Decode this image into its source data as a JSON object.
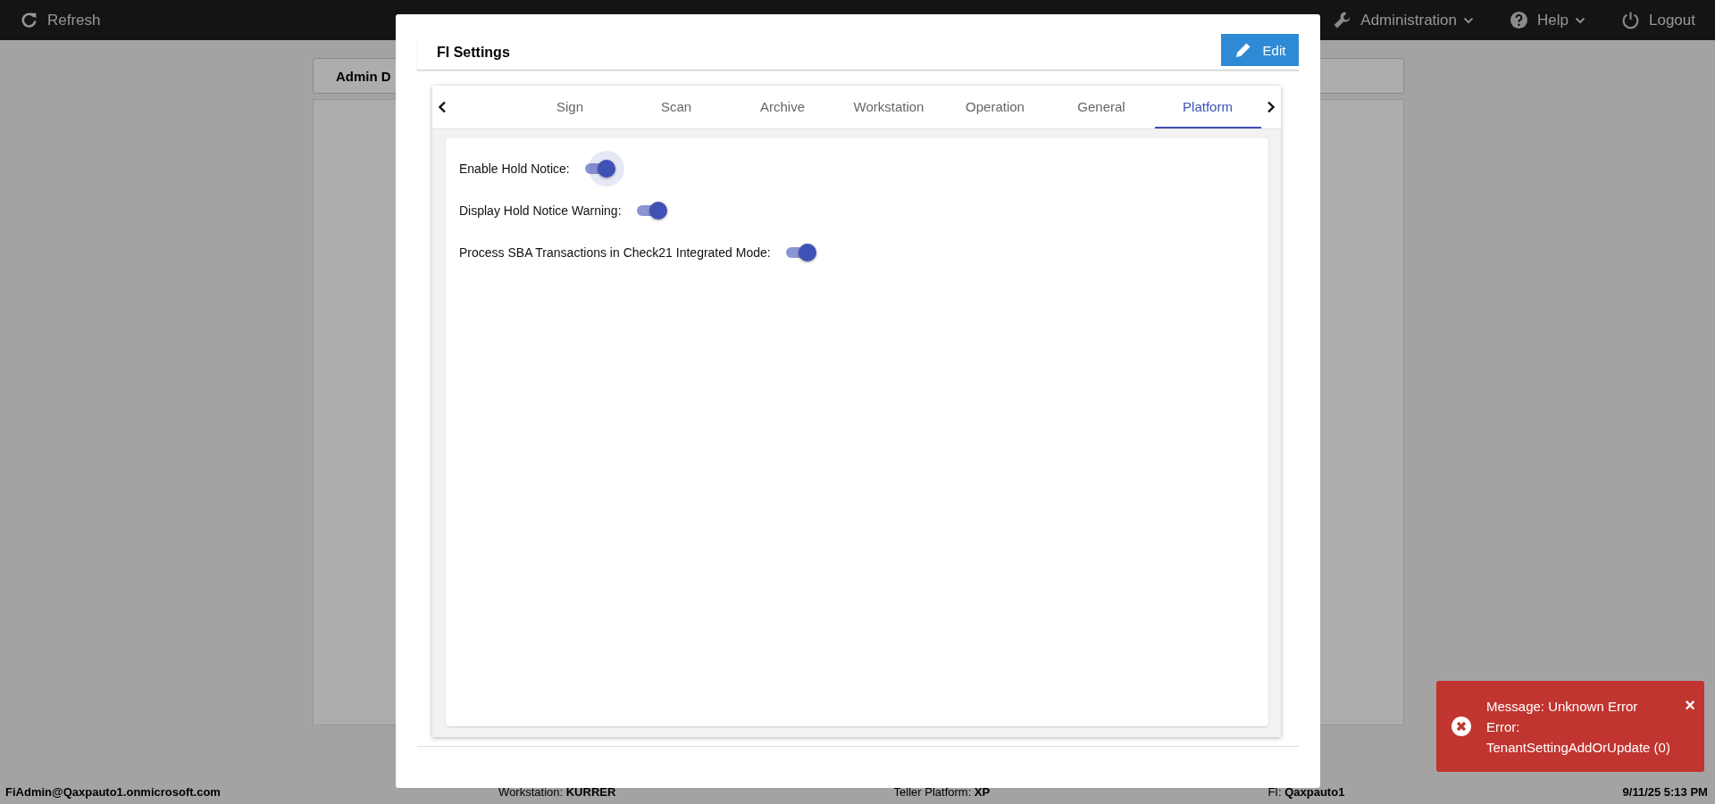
{
  "top_bar": {
    "refresh": "Refresh",
    "menus": [
      {
        "label": "Administration",
        "kind": "admin"
      },
      {
        "label": "Help",
        "kind": "help"
      },
      {
        "label": "Logout",
        "kind": "logout"
      }
    ]
  },
  "background": {
    "card_title": "Admin D"
  },
  "dialog": {
    "title": "FI Settings",
    "edit_button": "Edit",
    "tabs": [
      {
        "label": "Sign",
        "selected": false
      },
      {
        "label": "Scan",
        "selected": false
      },
      {
        "label": "Archive",
        "selected": false
      },
      {
        "label": "Workstation",
        "selected": false
      },
      {
        "label": "Operation",
        "selected": false
      },
      {
        "label": "General",
        "selected": false
      },
      {
        "label": "Platform",
        "selected": true
      }
    ],
    "settings": [
      {
        "label": "Enable Hold Notice:",
        "on": true,
        "focused": true
      },
      {
        "label": "Display Hold Notice Warning:",
        "on": true,
        "focused": false
      },
      {
        "label": "Process SBA Transactions in Check21 Integrated Mode:",
        "on": true,
        "focused": false
      }
    ]
  },
  "toast": {
    "lines": [
      "Message: Unknown Error",
      "Error:",
      "TenantSettingAddOrUpdate (0)"
    ],
    "close": "×"
  },
  "status_bar": {
    "user": "FiAdmin@Qaxpauto1.onmicrosoft.com",
    "items": [
      {
        "label": "Workstation:",
        "value": "KURRER"
      },
      {
        "label": "Teller Platform:",
        "value": "XP"
      },
      {
        "label": "FI:",
        "value": "Qaxpauto1"
      }
    ],
    "time": "9/11/25 5:13 PM"
  }
}
